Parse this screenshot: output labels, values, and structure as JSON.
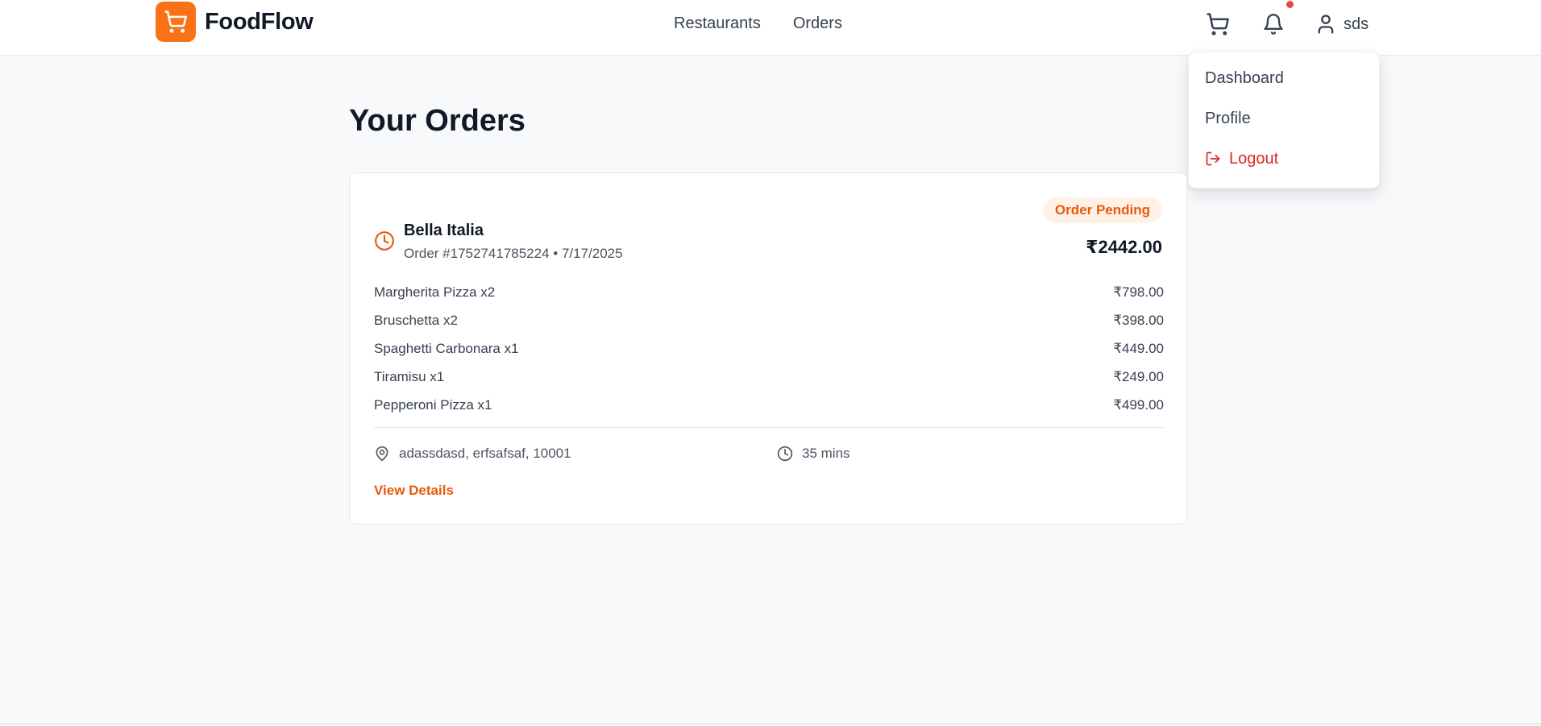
{
  "brand": {
    "name": "FoodFlow",
    "accent": "#f97316",
    "logo_icon": "shopping-cart-icon"
  },
  "nav": {
    "links": [
      "Restaurants",
      "Orders"
    ]
  },
  "user": {
    "name": "sds"
  },
  "dropdown": {
    "items": [
      "Dashboard",
      "Profile",
      "Logout"
    ]
  },
  "page": {
    "title": "Your Orders"
  },
  "order": {
    "restaurant": "Bella Italia",
    "meta": "Order #1752741785224 • 7/17/2025",
    "status": "Order Pending",
    "total": "₹2442.00",
    "items": [
      {
        "name": "Margherita Pizza x2",
        "price": "₹798.00"
      },
      {
        "name": "Bruschetta x2",
        "price": "₹398.00"
      },
      {
        "name": "Spaghetti Carbonara x1",
        "price": "₹449.00"
      },
      {
        "name": "Tiramisu x1",
        "price": "₹249.00"
      },
      {
        "name": "Pepperoni Pizza x1",
        "price": "₹499.00"
      }
    ],
    "address": "adassdasd, erfsafsaf, 10001",
    "eta": "35 mins",
    "details_label": "View Details"
  }
}
